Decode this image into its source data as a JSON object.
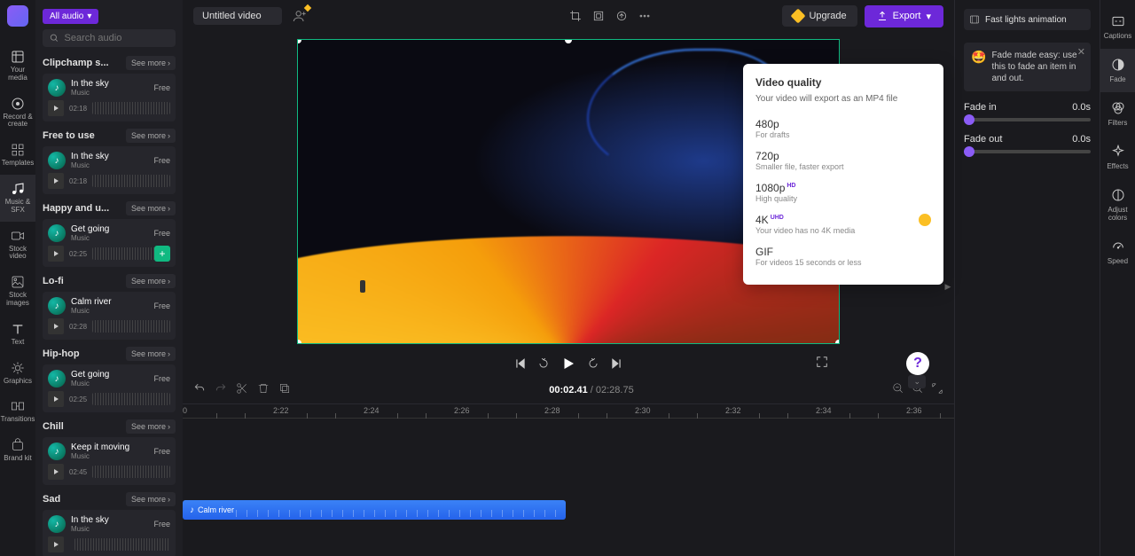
{
  "nav": {
    "items": [
      {
        "label": "Your media",
        "icon": "media"
      },
      {
        "label": "Record & create",
        "icon": "record"
      },
      {
        "label": "Templates",
        "icon": "templates"
      },
      {
        "label": "Music & SFX",
        "icon": "music",
        "active": true
      },
      {
        "label": "Stock video",
        "icon": "stockvideo"
      },
      {
        "label": "Stock images",
        "icon": "stockimg"
      },
      {
        "label": "Text",
        "icon": "text"
      },
      {
        "label": "Graphics",
        "icon": "graphics"
      },
      {
        "label": "Transitions",
        "icon": "transitions"
      },
      {
        "label": "Brand kit",
        "icon": "brandkit"
      }
    ]
  },
  "audio": {
    "filter": "All audio",
    "search_placeholder": "Search audio",
    "see_more": "See more",
    "categories": [
      {
        "title": "Clipchamp s...",
        "track": {
          "name": "In the sky",
          "type": "Music",
          "badge": "Free",
          "duration": "02:18"
        }
      },
      {
        "title": "Free to use",
        "track": {
          "name": "In the sky",
          "type": "Music",
          "badge": "Free",
          "duration": "02:18"
        }
      },
      {
        "title": "Happy and u...",
        "track": {
          "name": "Get going",
          "type": "Music",
          "badge": "Free",
          "duration": "02:25",
          "add": true
        }
      },
      {
        "title": "Lo-fi",
        "track": {
          "name": "Calm river",
          "type": "Music",
          "badge": "Free",
          "duration": "02:28"
        }
      },
      {
        "title": "Hip-hop",
        "track": {
          "name": "Get going",
          "type": "Music",
          "badge": "Free",
          "duration": "02:25"
        }
      },
      {
        "title": "Chill",
        "track": {
          "name": "Keep it moving",
          "type": "Music",
          "badge": "Free",
          "duration": "02:45"
        }
      },
      {
        "title": "Sad",
        "track": {
          "name": "In the sky",
          "type": "Music",
          "badge": "Free",
          "duration": ""
        }
      }
    ]
  },
  "topbar": {
    "title": "Untitled video",
    "upgrade": "Upgrade",
    "export": "Export"
  },
  "playback": {
    "current": "00:02.41",
    "separator": " / ",
    "total": "02:28.75"
  },
  "ruler": {
    "marks": [
      "0",
      "2:22",
      "2:24",
      "2:26",
      "2:28",
      "2:30",
      "2:32",
      "2:34",
      "2:36"
    ]
  },
  "clip": {
    "name": "Calm river"
  },
  "export_popup": {
    "title": "Video quality",
    "subtitle": "Your video will export as an MP4 file",
    "options": [
      {
        "title": "480p",
        "sub": "For drafts"
      },
      {
        "title": "720p",
        "sub": "Smaller file, faster export"
      },
      {
        "title": "1080p",
        "badge": "HD",
        "sub": "High quality"
      },
      {
        "title": "4K",
        "badge": "UHD",
        "sub": "Your video has no 4K media",
        "premium": true
      },
      {
        "title": "GIF",
        "sub": "For videos 15 seconds or less"
      }
    ]
  },
  "right_panel": {
    "setting": "Fast lights animation",
    "tip": "Fade made easy: use this to fade an item in and out.",
    "fade_in": {
      "label": "Fade in",
      "value": "0.0s"
    },
    "fade_out": {
      "label": "Fade out",
      "value": "0.0s"
    }
  },
  "tool_rail": {
    "items": [
      {
        "label": "Captions"
      },
      {
        "label": "Fade",
        "active": true
      },
      {
        "label": "Filters"
      },
      {
        "label": "Effects"
      },
      {
        "label": "Adjust colors"
      },
      {
        "label": "Speed"
      }
    ]
  },
  "help": "?"
}
